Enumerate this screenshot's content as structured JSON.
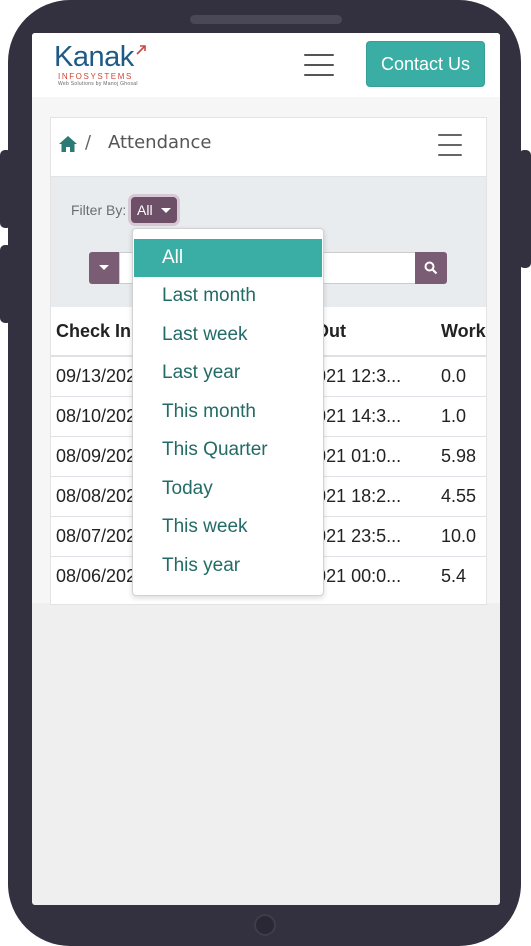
{
  "brand": {
    "logo_main": "Kanak",
    "logo_sub": "INFOSYSTEMS",
    "logo_tagline": "Web Solutions by Manoj Ghosal"
  },
  "navbar": {
    "contact_label": "Contact Us",
    "menu_icon": "hamburger-icon"
  },
  "breadcrumb": {
    "home_icon": "home-icon",
    "separator": "/",
    "current": "Attendance",
    "menu_icon": "hamburger-icon"
  },
  "filter": {
    "label": "Filter By:",
    "selected": "All",
    "search_icon": "search-icon"
  },
  "dropdown": {
    "options": [
      "All",
      "Last month",
      "Last week",
      "Last year",
      "This month",
      "This Quarter",
      "Today",
      "This week",
      "This year"
    ],
    "active_index": 0
  },
  "table": {
    "headers": [
      "Check In",
      "Check Out",
      "Work"
    ],
    "rows": [
      [
        "09/13/2021 07:2...",
        "09/13/2021 12:3...",
        "0.0"
      ],
      [
        "08/10/2021 13:2...",
        "08/10/2021 14:3...",
        "1.0"
      ],
      [
        "08/09/2021 19:0...",
        "08/10/2021 01:0...",
        "5.98"
      ],
      [
        "08/08/2021 13:4...",
        "08/08/2021 18:2...",
        "4.55"
      ],
      [
        "08/07/2021 13:5...",
        "08/07/2021 23:5...",
        "10.0"
      ],
      [
        "08/06/2021 18:3...",
        "08/07/2021 00:0...",
        "5.4"
      ]
    ]
  },
  "colors": {
    "accent": "#3aada5",
    "filter_button": "#6d4f68",
    "brand_blue": "#1f5a86",
    "brand_red": "#d0453d"
  }
}
